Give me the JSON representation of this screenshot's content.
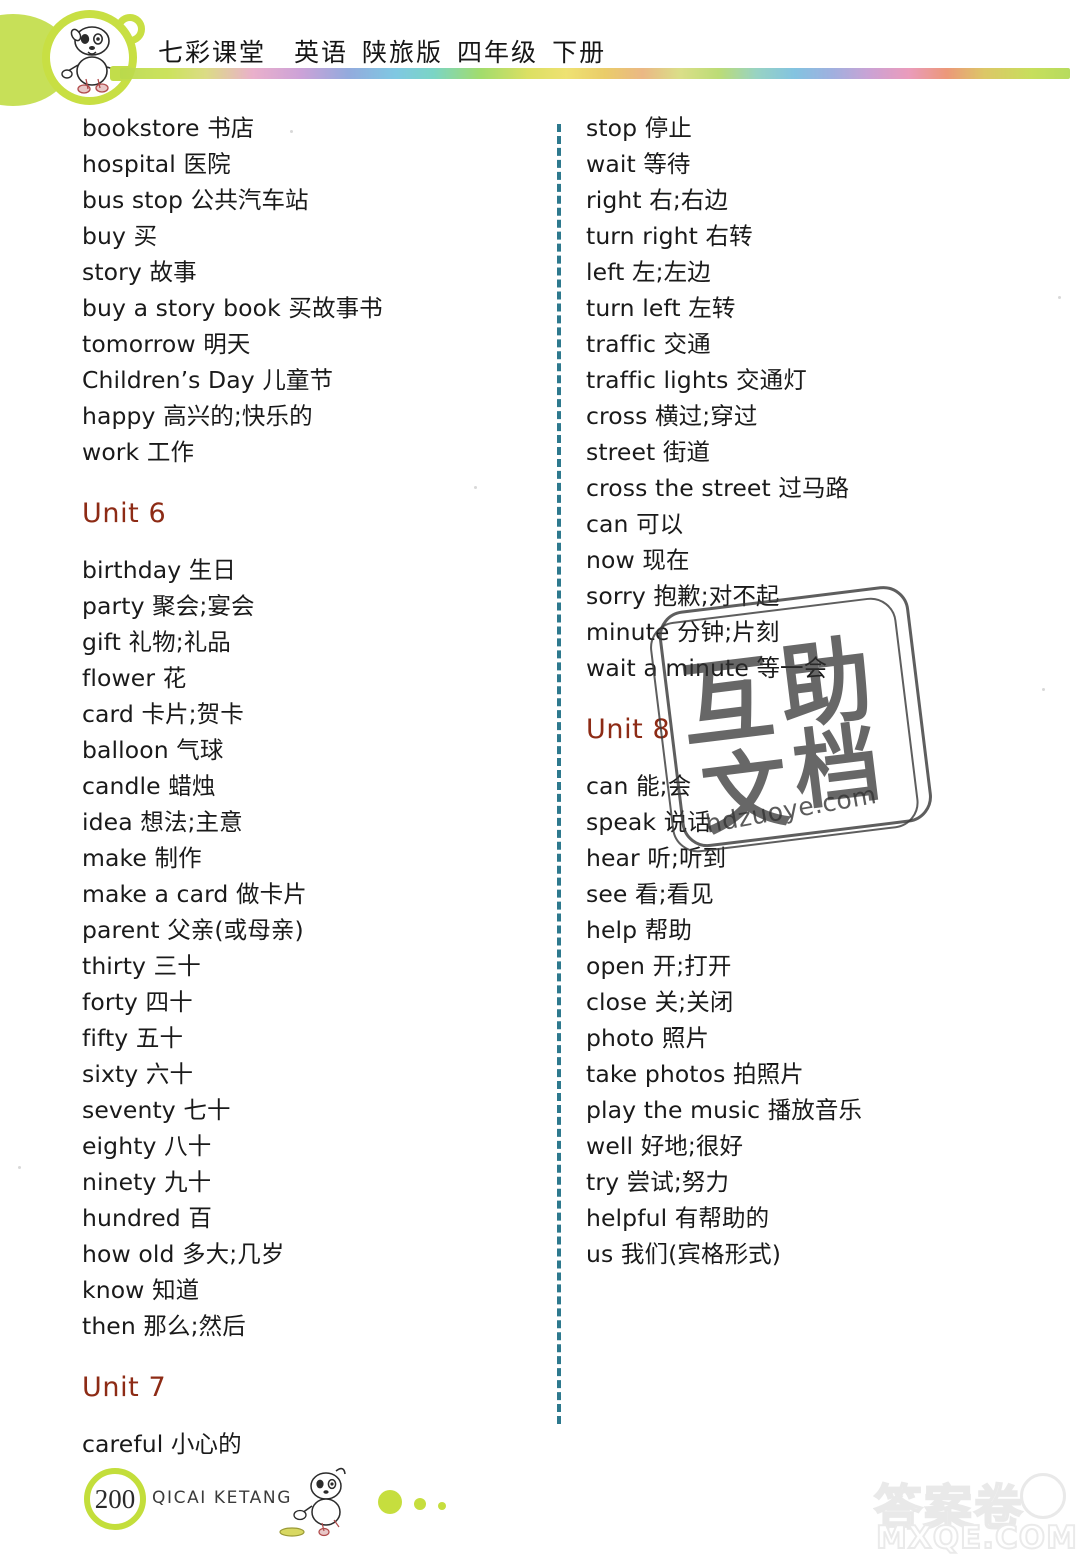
{
  "header": {
    "title": "七彩课堂  英语 陕旅版 四年级 下册",
    "title_parts": [
      "七彩课堂",
      "英语",
      "陕旅版",
      "四年级",
      "下册"
    ],
    "mascot_icon": "dog-mascot-icon",
    "accent_green": "#c3de3b"
  },
  "columns": {
    "left": [
      {
        "type": "entry",
        "en": "bookstore",
        "zh": "书店",
        "text": "bookstore 书店"
      },
      {
        "type": "entry",
        "en": "hospital",
        "zh": "医院",
        "text": "hospital 医院"
      },
      {
        "type": "entry",
        "en": "bus stop",
        "zh": "公共汽车站",
        "text": "bus stop 公共汽车站"
      },
      {
        "type": "entry",
        "en": "buy",
        "zh": "买",
        "text": "buy 买"
      },
      {
        "type": "entry",
        "en": "story",
        "zh": "故事",
        "text": "story 故事"
      },
      {
        "type": "entry",
        "en": "buy a story book",
        "zh": "买故事书",
        "text": "buy a story book 买故事书"
      },
      {
        "type": "entry",
        "en": "tomorrow",
        "zh": "明天",
        "text": "tomorrow 明天"
      },
      {
        "type": "entry",
        "en": "Children's Day",
        "zh": "儿童节",
        "text": "Children’s Day 儿童节"
      },
      {
        "type": "entry",
        "en": "happy",
        "zh": "高兴的;快乐的",
        "text": "happy 高兴的;快乐的"
      },
      {
        "type": "entry",
        "en": "work",
        "zh": "工作",
        "text": "work 工作"
      },
      {
        "type": "unit",
        "text": "Unit 6"
      },
      {
        "type": "entry",
        "en": "birthday",
        "zh": "生日",
        "text": "birthday 生日"
      },
      {
        "type": "entry",
        "en": "party",
        "zh": "聚会;宴会",
        "text": "party 聚会;宴会"
      },
      {
        "type": "entry",
        "en": "gift",
        "zh": "礼物;礼品",
        "text": "gift 礼物;礼品"
      },
      {
        "type": "entry",
        "en": "flower",
        "zh": "花",
        "text": "flower 花"
      },
      {
        "type": "entry",
        "en": "card",
        "zh": "卡片;贺卡",
        "text": "card 卡片;贺卡"
      },
      {
        "type": "entry",
        "en": "balloon",
        "zh": "气球",
        "text": "balloon 气球"
      },
      {
        "type": "entry",
        "en": "candle",
        "zh": "蜡烛",
        "text": "candle 蜡烛"
      },
      {
        "type": "entry",
        "en": "idea",
        "zh": "想法;主意",
        "text": "idea 想法;主意"
      },
      {
        "type": "entry",
        "en": "make",
        "zh": "制作",
        "text": "make 制作"
      },
      {
        "type": "entry",
        "en": "make a card",
        "zh": "做卡片",
        "text": "make a card 做卡片"
      },
      {
        "type": "entry",
        "en": "parent",
        "zh": "父亲(或母亲)",
        "text": "parent 父亲(或母亲)"
      },
      {
        "type": "entry",
        "en": "thirty",
        "zh": "三十",
        "text": "thirty 三十"
      },
      {
        "type": "entry",
        "en": "forty",
        "zh": "四十",
        "text": "forty 四十"
      },
      {
        "type": "entry",
        "en": "fifty",
        "zh": "五十",
        "text": "fifty 五十"
      },
      {
        "type": "entry",
        "en": "sixty",
        "zh": "六十",
        "text": "sixty 六十"
      },
      {
        "type": "entry",
        "en": "seventy",
        "zh": "七十",
        "text": "seventy 七十"
      },
      {
        "type": "entry",
        "en": "eighty",
        "zh": "八十",
        "text": "eighty 八十"
      },
      {
        "type": "entry",
        "en": "ninety",
        "zh": "九十",
        "text": "ninety 九十"
      },
      {
        "type": "entry",
        "en": "hundred",
        "zh": "百",
        "text": "hundred 百"
      },
      {
        "type": "entry",
        "en": "how old",
        "zh": "多大;几岁",
        "text": "how old 多大;几岁"
      },
      {
        "type": "entry",
        "en": "know",
        "zh": "知道",
        "text": "know 知道"
      },
      {
        "type": "entry",
        "en": "then",
        "zh": "那么;然后",
        "text": "then 那么;然后"
      },
      {
        "type": "unit",
        "text": "Unit 7"
      },
      {
        "type": "entry",
        "en": "careful",
        "zh": "小心的",
        "text": "careful 小心的"
      }
    ],
    "right": [
      {
        "type": "entry",
        "en": "stop",
        "zh": "停止",
        "text": "stop 停止"
      },
      {
        "type": "entry",
        "en": "wait",
        "zh": "等待",
        "text": "wait 等待"
      },
      {
        "type": "entry",
        "en": "right",
        "zh": "右;右边",
        "text": "right 右;右边"
      },
      {
        "type": "entry",
        "en": "turn right",
        "zh": "右转",
        "text": "turn right 右转"
      },
      {
        "type": "entry",
        "en": "left",
        "zh": "左;左边",
        "text": "left 左;左边"
      },
      {
        "type": "entry",
        "en": "turn left",
        "zh": "左转",
        "text": "turn left 左转"
      },
      {
        "type": "entry",
        "en": "traffic",
        "zh": "交通",
        "text": "traffic 交通"
      },
      {
        "type": "entry",
        "en": "traffic lights",
        "zh": "交通灯",
        "text": "traffic lights 交通灯"
      },
      {
        "type": "entry",
        "en": "cross",
        "zh": "横过;穿过",
        "text": "cross 横过;穿过"
      },
      {
        "type": "entry",
        "en": "street",
        "zh": "街道",
        "text": "street 街道"
      },
      {
        "type": "entry",
        "en": "cross the street",
        "zh": "过马路",
        "text": "cross the street 过马路"
      },
      {
        "type": "entry",
        "en": "can",
        "zh": "可以",
        "text": "can 可以"
      },
      {
        "type": "entry",
        "en": "now",
        "zh": "现在",
        "text": "now 现在"
      },
      {
        "type": "entry",
        "en": "sorry",
        "zh": "抱歉;对不起",
        "text": "sorry 抱歉;对不起"
      },
      {
        "type": "entry",
        "en": "minute",
        "zh": "分钟;片刻",
        "text": "minute 分钟;片刻"
      },
      {
        "type": "entry",
        "en": "wait a minute",
        "zh": "等一会",
        "text": "wait a minute 等一会"
      },
      {
        "type": "unit",
        "text": "Unit 8"
      },
      {
        "type": "entry",
        "en": "can",
        "zh": "能;会",
        "text": "can 能;会"
      },
      {
        "type": "entry",
        "en": "speak",
        "zh": "说话",
        "text": "speak 说话"
      },
      {
        "type": "entry",
        "en": "hear",
        "zh": "听;听到",
        "text": "hear 听;听到"
      },
      {
        "type": "entry",
        "en": "see",
        "zh": "看;看见",
        "text": "see 看;看见"
      },
      {
        "type": "entry",
        "en": "help",
        "zh": "帮助",
        "text": "help 帮助"
      },
      {
        "type": "entry",
        "en": "open",
        "zh": "开;打开",
        "text": "open 开;打开"
      },
      {
        "type": "entry",
        "en": "close",
        "zh": "关;关闭",
        "text": "close 关;关闭"
      },
      {
        "type": "entry",
        "en": "photo",
        "zh": "照片",
        "text": "photo 照片"
      },
      {
        "type": "entry",
        "en": "take photos",
        "zh": "拍照片",
        "text": "take photos 拍照片"
      },
      {
        "type": "entry",
        "en": "play the music",
        "zh": "播放音乐",
        "text": "play the music 播放音乐"
      },
      {
        "type": "entry",
        "en": "well",
        "zh": "好地;很好",
        "text": "well 好地;很好"
      },
      {
        "type": "entry",
        "en": "try",
        "zh": "尝试;努力",
        "text": "try 尝试;努力"
      },
      {
        "type": "entry",
        "en": "helpful",
        "zh": "有帮助的",
        "text": "helpful 有帮助的"
      },
      {
        "type": "entry",
        "en": "us",
        "zh": "我们(宾格形式)",
        "text": "us 我们(宾格形式)"
      }
    ]
  },
  "stamp_watermark": {
    "chars": [
      "互",
      "助",
      "文",
      "档"
    ],
    "char_hu": "互",
    "char_zhu": "助",
    "char_wen": "文",
    "char_dang": "档",
    "url": "hdzuoye.com"
  },
  "footer": {
    "page_number": "200",
    "brand": "QICAI  KETANG",
    "mascot_icon": "dog-running-icon"
  },
  "corner_watermark": {
    "cn": "答案卷",
    "url": "MXQE.COM"
  }
}
